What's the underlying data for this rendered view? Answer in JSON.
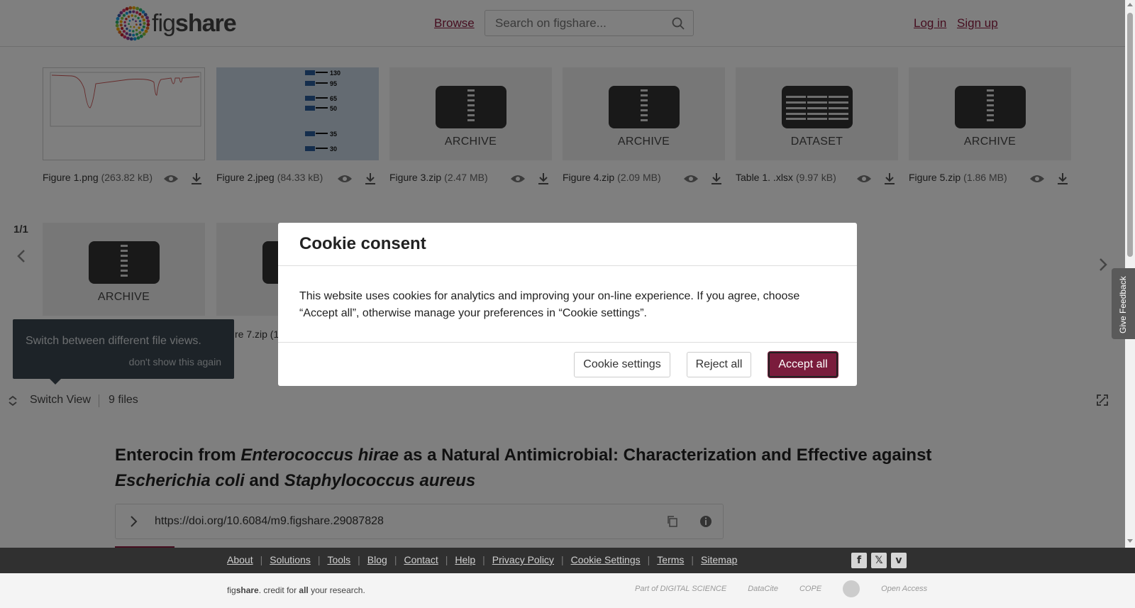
{
  "header": {
    "logo_prefix": "fig",
    "logo_suffix": "share",
    "browse_label": "Browse",
    "search_placeholder": "Search on figshare...",
    "login_label": "Log in",
    "signup_label": "Sign up"
  },
  "files_row1": [
    {
      "name": "Figure 1.png",
      "size": "(263.82 kB)",
      "type": "image-chart"
    },
    {
      "name": "Figure 2.jpeg",
      "size": "(84.33 kB)",
      "type": "image-blot",
      "blot_labels": [
        "130",
        "95",
        "65",
        "50",
        "35",
        "30"
      ]
    },
    {
      "name": "Figure 3.zip",
      "size": "(2.47 MB)",
      "type": "ARCHIVE"
    },
    {
      "name": "Figure 4.zip",
      "size": "(2.09 MB)",
      "type": "ARCHIVE"
    },
    {
      "name": "Table 1. .xlsx",
      "size": "(9.97 kB)",
      "type": "DATASET"
    },
    {
      "name": "Figure 5.zip",
      "size": "(1.86 MB)",
      "type": "ARCHIVE"
    }
  ],
  "files_row2": [
    {
      "name": "",
      "size": "",
      "type": "ARCHIVE"
    },
    {
      "name": "re 7.zip (1",
      "size": "",
      "type": "A"
    }
  ],
  "pagination": {
    "indicator": "1/1"
  },
  "tooltip": {
    "text": "Switch between different file views.",
    "dismiss": "don't show this again"
  },
  "switch_bar": {
    "switch_label": "Switch View",
    "files_count": "9 files"
  },
  "article": {
    "title_parts": [
      {
        "text": "Enterocin from ",
        "italic": false
      },
      {
        "text": "Enterococcus hirae",
        "italic": true
      },
      {
        "text": " as a Natural Antimicrobial: Characterization and Effective against ",
        "italic": false
      },
      {
        "text": "Escherichia coli",
        "italic": true
      },
      {
        "text": " and ",
        "italic": false
      },
      {
        "text": "Staphylococcus aureus",
        "italic": true
      }
    ],
    "doi": "https://doi.org/10.6084/m9.figshare.29087828"
  },
  "footer": {
    "links": [
      "About",
      "Solutions",
      "Tools",
      "Blog",
      "Contact",
      "Help",
      "Privacy Policy",
      "Cookie Settings",
      "Terms",
      "Sitemap"
    ],
    "social": [
      "facebook-icon",
      "x-icon",
      "vimeo-icon"
    ],
    "tagline_prefix": "fig",
    "tagline_brand": "share",
    "tagline_mid": ". credit for ",
    "tagline_bold": "all",
    "tagline_end": " your research.",
    "partners": [
      "Part of DIGITAL SCIENCE",
      "DataCite",
      "COPE",
      "",
      "Open Access"
    ]
  },
  "feedback": {
    "label": "Give Feedback"
  },
  "cookie_modal": {
    "title": "Cookie consent",
    "body": "This website uses cookies for analytics and improving your on-line experience. If you agree, choose “Accept all”, otherwise manage your preferences in “Cookie settings”.",
    "settings_label": "Cookie settings",
    "reject_label": "Reject all",
    "accept_label": "Accept all"
  },
  "colors": {
    "accent": "#8c1d40",
    "accept_button": "#7a1c3c",
    "footer_bg": "#303030"
  }
}
